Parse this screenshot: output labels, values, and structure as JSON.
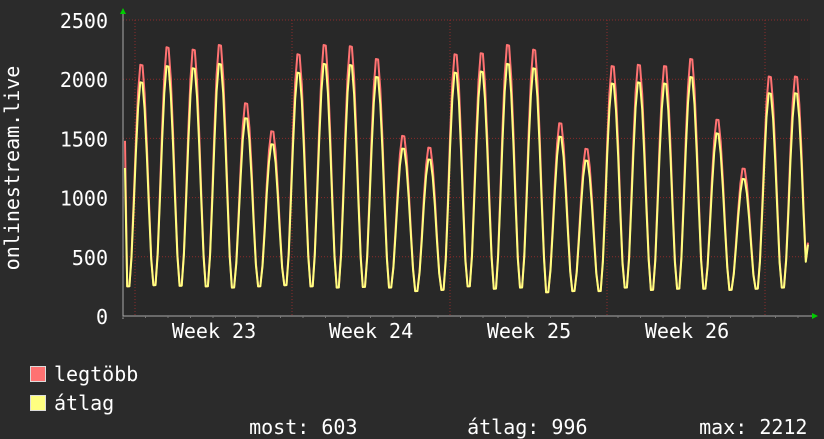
{
  "chart_data": {
    "type": "line",
    "ylabel": "onlinestream.live",
    "ylim": [
      0,
      2500
    ],
    "y_ticks": [
      "0",
      "500",
      "1000",
      "1500",
      "2000",
      "2500"
    ],
    "x_ticks": [
      "Week 23",
      "Week 24",
      "Week 25",
      "Week 26"
    ],
    "grid": true,
    "colors": {
      "background": "#2b2b2b",
      "plot_background": "#282828",
      "grid": "#8b2b2b",
      "max_series": "#ff7272",
      "avg_series": "#ffff80",
      "axis": "#aaaaaa",
      "arrow": "#00cc00"
    },
    "daily": {
      "peak_max": [
        2150,
        2300,
        2280,
        2320,
        1820,
        1580,
        2240,
        2320,
        2310,
        2200,
        1540,
        1440,
        2240,
        2250,
        2320,
        2280,
        1650,
        1430,
        2140,
        2150,
        2140,
        2200,
        1680,
        1260,
        2050,
        2050
      ],
      "trough": [
        250,
        260,
        255,
        250,
        240,
        250,
        260,
        250,
        240,
        245,
        240,
        210,
        220,
        250,
        230,
        240,
        200,
        210,
        210,
        240,
        220,
        230,
        230,
        220,
        230,
        240
      ]
    },
    "series": [
      {
        "name": "legtöbb",
        "values": []
      },
      {
        "name": "átlag",
        "values": []
      }
    ],
    "stats": {
      "most_label": "most:",
      "most_value": "603",
      "atlag_label": "átlag:",
      "atlag_value": "996",
      "max_label": "max:",
      "max_value": "2212"
    }
  },
  "legend": {
    "max_label": "legtöbb",
    "avg_label": "átlag"
  }
}
